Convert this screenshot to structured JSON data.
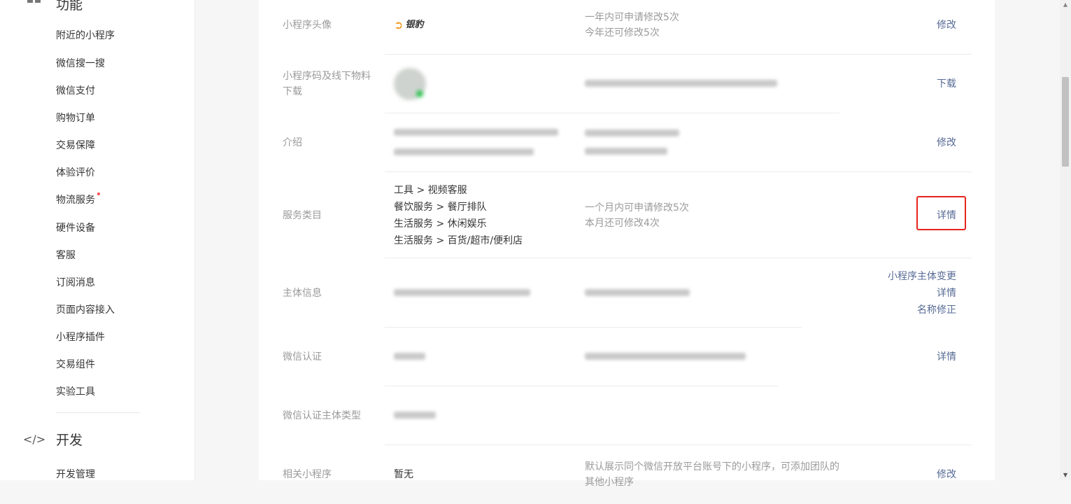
{
  "sidebar": {
    "feature_header": "功能",
    "items": [
      {
        "label": "附近的小程序"
      },
      {
        "label": "微信搜一搜"
      },
      {
        "label": "微信支付"
      },
      {
        "label": "购物订单"
      },
      {
        "label": "交易保障"
      },
      {
        "label": "体验评价"
      },
      {
        "label": "物流服务",
        "has_dot": true
      },
      {
        "label": "硬件设备"
      },
      {
        "label": "客服"
      },
      {
        "label": "订阅消息"
      },
      {
        "label": "页面内容接入"
      },
      {
        "label": "小程序插件"
      },
      {
        "label": "交易组件"
      },
      {
        "label": "实验工具"
      }
    ],
    "dev_header": "开发",
    "dev_icon": "code-icon",
    "dev_items": [
      {
        "label": "开发管理"
      }
    ]
  },
  "rows": {
    "avatar": {
      "label": "小程序头像",
      "logo_text": "银豹",
      "desc_line1": "一年内可申请修改5次",
      "desc_line2": "今年还可修改5次",
      "action": "修改"
    },
    "qrcode": {
      "label": "小程序码及线下物料下载",
      "action": "下载"
    },
    "intro": {
      "label": "介绍",
      "action": "修改"
    },
    "category": {
      "label": "服务类目",
      "values": [
        "工具 > 视频客服",
        "餐饮服务 > 餐厅排队",
        "生活服务 > 休闲娱乐",
        "生活服务 > 百货/超市/便利店"
      ],
      "desc_line1": "一个月内可申请修改5次",
      "desc_line2": "本月还可修改4次",
      "action": "详情"
    },
    "entity": {
      "label": "主体信息",
      "actions": [
        "小程序主体变更",
        "详情",
        "名称修正"
      ]
    },
    "cert": {
      "label": "微信认证",
      "action": "详情"
    },
    "cert_type": {
      "label": "微信认证主体类型"
    },
    "related": {
      "label": "相关小程序",
      "value": "暂无",
      "desc_line1": "默认展示同个微信开放平台账号下的小程序，可添加团队的",
      "desc_line2": "其他小程序",
      "action": "修改"
    }
  },
  "colors": {
    "link": "#576b95",
    "highlight": "#e5231d",
    "label_gray": "#9a9a9a"
  }
}
